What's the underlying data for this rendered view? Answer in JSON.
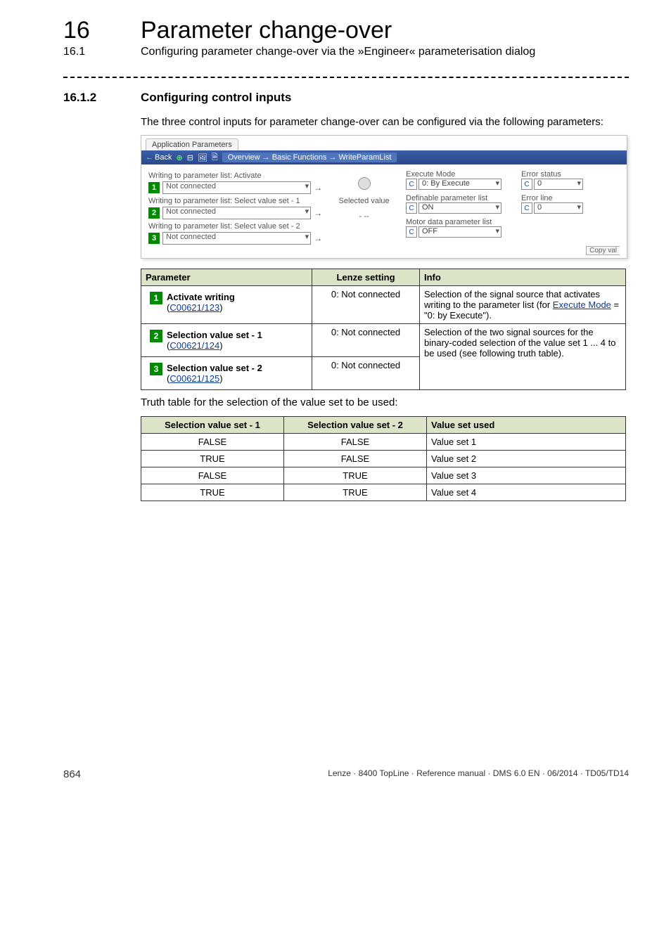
{
  "chapter": {
    "num": "16",
    "title": "Parameter change-over"
  },
  "subsection": {
    "num": "16.1",
    "title": "Configuring parameter change-over via the »Engineer« parameterisation dialog"
  },
  "section": {
    "num": "16.1.2",
    "title": "Configuring control inputs"
  },
  "intro": "The three control inputs for parameter change-over can be configured via the following parameters:",
  "app": {
    "tab": "Application Parameters",
    "toolbar": {
      "back": "Back",
      "path": "Overview → Basic Functions → WriteParamList"
    },
    "left": {
      "label0": "Writing to parameter list: Activate",
      "label1": "Writing to parameter list: Select value set - 1",
      "label2": "Writing to parameter list: Select value set - 2",
      "dropval": "Not connected"
    },
    "mid": {
      "label": "Selected value",
      "dashes": "- --"
    },
    "right": {
      "exec_label": "Execute Mode",
      "exec_value": "0: By Execute",
      "def_label": "Definable parameter list",
      "def_value": "ON",
      "motor_label": "Motor data parameter list",
      "motor_value": "OFF",
      "status_label": "Error status",
      "status_value": "0",
      "line_label": "Error line",
      "line_value": "0"
    },
    "btnC": "C",
    "copy": "Copy val"
  },
  "ptable": {
    "headers": [
      "Parameter",
      "Lenze setting",
      "Info"
    ],
    "rows": [
      {
        "badge": "1",
        "name": "Activate writing",
        "code": "C00621/123",
        "setting": "0: Not connected",
        "info_pre": "Selection of the signal source that activates writing to the parameter list (for ",
        "info_link": "Execute Mode",
        "info_post": " = \"0: by Execute\").",
        "rowspan": 1
      },
      {
        "badge": "2",
        "name": "Selection value set - 1",
        "code": "C00621/124",
        "setting": "0: Not connected",
        "info": "Selection of the two signal sources for the binary-coded selection of the value set 1 ... 4 to be used (see following truth table).",
        "rowspan": 2
      },
      {
        "badge": "3",
        "name": "Selection value set - 2",
        "code": "C00621/125",
        "setting": "0: Not connected"
      }
    ]
  },
  "truth_caption": "Truth table for the selection of the value set to be used:",
  "ttable": {
    "headers": [
      "Selection value set - 1",
      "Selection value set - 2",
      "Value set used"
    ],
    "rows": [
      [
        "FALSE",
        "FALSE",
        "Value set 1"
      ],
      [
        "TRUE",
        "FALSE",
        "Value set 2"
      ],
      [
        "FALSE",
        "TRUE",
        "Value set 3"
      ],
      [
        "TRUE",
        "TRUE",
        "Value set 4"
      ]
    ]
  },
  "footer": {
    "page": "864",
    "right": "Lenze · 8400 TopLine · Reference manual · DMS 6.0 EN · 06/2014 · TD05/TD14"
  },
  "chart_data": {
    "type": "table",
    "title": "Truth table for the selection of the value set to be used",
    "columns": [
      "Selection value set - 1",
      "Selection value set - 2",
      "Value set used"
    ],
    "rows": [
      [
        "FALSE",
        "FALSE",
        "Value set 1"
      ],
      [
        "TRUE",
        "FALSE",
        "Value set 2"
      ],
      [
        "FALSE",
        "TRUE",
        "Value set 3"
      ],
      [
        "TRUE",
        "TRUE",
        "Value set 4"
      ]
    ]
  }
}
